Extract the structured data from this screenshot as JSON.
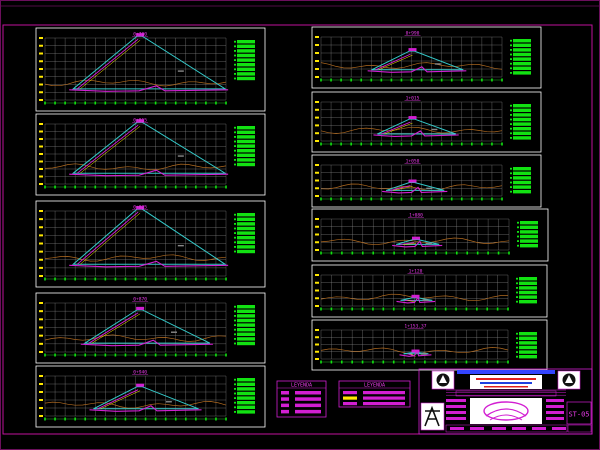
{
  "colors": {
    "background": "#000000",
    "frame": "#c0129c",
    "panel_border": "#ffffff",
    "grid": "#8a8a8a",
    "ground_line": "#b06a20",
    "embankment": "#34c9c9",
    "core": "#d21fd2",
    "label": "#e83be8",
    "axis_marks": "#ffe800",
    "table_green": "#12e212",
    "gridline_green": "#21b521"
  },
  "sections_left": [
    {
      "label": "0+700"
    },
    {
      "label": "0+815"
    },
    {
      "label": "0+825"
    },
    {
      "label": "0+870"
    },
    {
      "label": "0+940"
    }
  ],
  "sections_right": [
    {
      "label": "0+990"
    },
    {
      "label": "1+015"
    },
    {
      "label": "1+050"
    },
    {
      "label": "1+080"
    },
    {
      "label": "1+120"
    },
    {
      "label": "1+153.37"
    }
  ],
  "legend_1": {
    "title": "LEYENDA"
  },
  "legend_2": {
    "title": "LEYENDA"
  },
  "title_block": {
    "sheet_number": "ST-05"
  }
}
